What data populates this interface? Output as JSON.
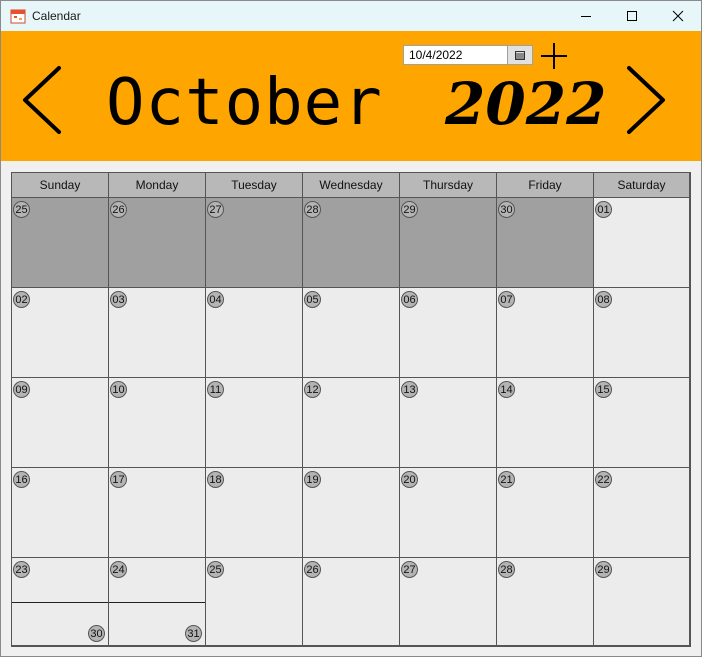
{
  "window": {
    "title": "Calendar"
  },
  "header": {
    "month": "October",
    "year": "2022",
    "date_value": "10/4/2022",
    "colors": {
      "banner": "#ffa500"
    }
  },
  "weekdays": [
    "Sunday",
    "Monday",
    "Tuesday",
    "Wednesday",
    "Thursday",
    "Friday",
    "Saturday"
  ],
  "weeks": [
    [
      {
        "day": "25",
        "other": true
      },
      {
        "day": "26",
        "other": true
      },
      {
        "day": "27",
        "other": true
      },
      {
        "day": "28",
        "other": true
      },
      {
        "day": "29",
        "other": true
      },
      {
        "day": "30",
        "other": true
      },
      {
        "day": "01",
        "other": false
      }
    ],
    [
      {
        "day": "02"
      },
      {
        "day": "03"
      },
      {
        "day": "04"
      },
      {
        "day": "05"
      },
      {
        "day": "06"
      },
      {
        "day": "07"
      },
      {
        "day": "08"
      }
    ],
    [
      {
        "day": "09"
      },
      {
        "day": "10"
      },
      {
        "day": "11"
      },
      {
        "day": "12"
      },
      {
        "day": "13"
      },
      {
        "day": "14"
      },
      {
        "day": "15"
      }
    ],
    [
      {
        "day": "16"
      },
      {
        "day": "17"
      },
      {
        "day": "18"
      },
      {
        "day": "19"
      },
      {
        "day": "20"
      },
      {
        "day": "21"
      },
      {
        "day": "22"
      }
    ],
    [
      {
        "day": "23",
        "extra": "30"
      },
      {
        "day": "24",
        "extra": "31"
      },
      {
        "day": "25"
      },
      {
        "day": "26"
      },
      {
        "day": "27"
      },
      {
        "day": "28"
      },
      {
        "day": "29"
      }
    ]
  ]
}
